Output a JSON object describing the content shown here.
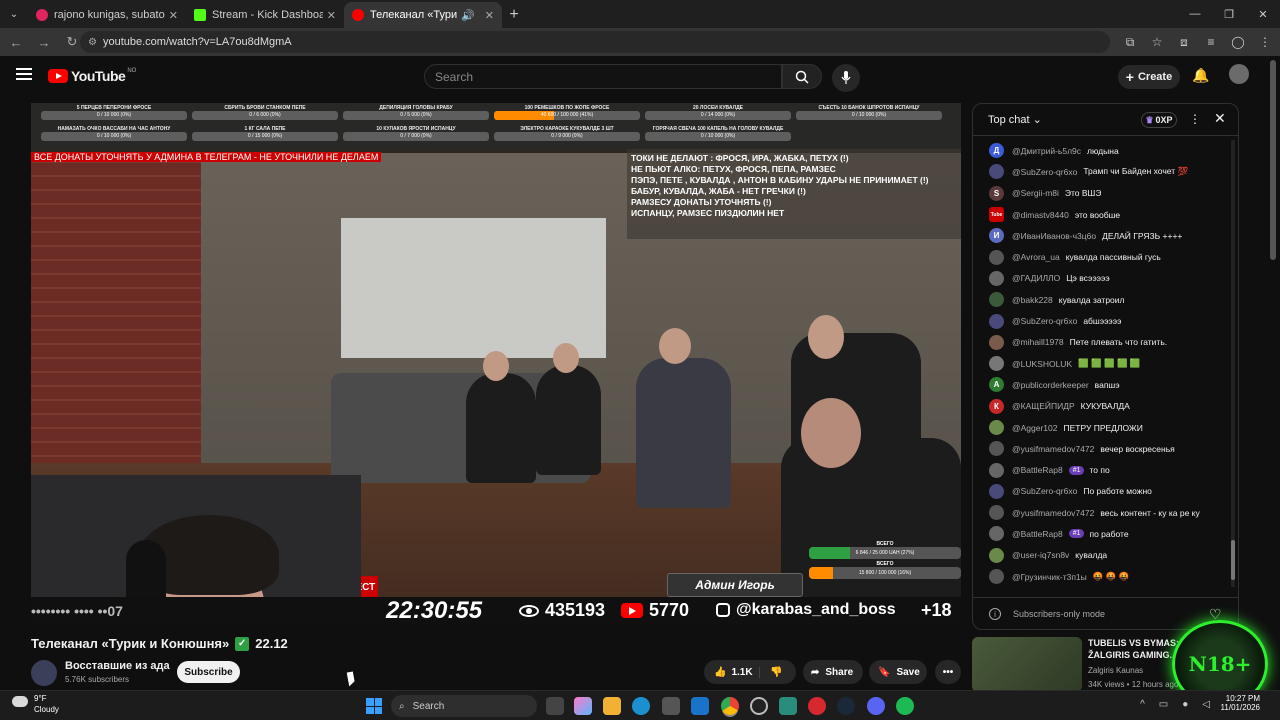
{
  "browser": {
    "tabs": [
      {
        "label": "rajono kunigas, subatono mor",
        "favicon_color": "#e0245e",
        "active": false
      },
      {
        "label": "Stream - Kick Dashboard",
        "favicon_color": "#53fc18",
        "active": false
      },
      {
        "label": "Телеканал «Турик и Конюш",
        "favicon_color": "#ff0000",
        "active": true
      }
    ],
    "url": "youtube.com/watch?v=LA7ou8dMgmA"
  },
  "youtube": {
    "logo_text": "YouTube",
    "logo_region": "NO",
    "search_placeholder": "Search",
    "create_label": "Create"
  },
  "stream_overlay": {
    "goals": [
      {
        "name": "5 ПЕРЦЕВ ПЕПЕРОНИ ФРОСЕ",
        "value": "0 / 10 000 (0%)",
        "progress": 0
      },
      {
        "name": "СБРИТЬ БРОВИ СТАНКОМ ПЕПЕ",
        "value": "0 / 6 000 (0%)",
        "progress": 0
      },
      {
        "name": "ДЕПИЛЯЦИЯ ГОЛОВЫ КРАБУ",
        "value": "0 / 5 000 (0%)",
        "progress": 0
      },
      {
        "name": "100 РЕМЕШКОВ ПО ЖОПЕ ФРОСЕ",
        "value": "40 600 / 100 000 (41%)",
        "progress": 0.41
      },
      {
        "name": "20 ЛОСЕЙ КУВАЛДЕ",
        "value": "0 / 14 000 (0%)",
        "progress": 0
      },
      {
        "name": "СЪЕСТЬ 10 БАНОК ШПРОТОВ ИСПАНЦУ",
        "value": "0 / 10 000 (0%)",
        "progress": 0
      },
      {
        "name": "НАМАЗАТЬ ОЧКО ВАССАБИ НА ЧАС АНТОНУ",
        "value": "0 / 10 000 (0%)",
        "progress": 0
      },
      {
        "name": "1 КГ САЛА ПЕПЕ",
        "value": "0 / 15 000 (0%)",
        "progress": 0
      },
      {
        "name": "10 КУЛАКОВ ЯРОСТИ ИСПАНЦУ",
        "value": "0 / 7 000 (0%)",
        "progress": 0
      },
      {
        "name": "ЭЛЕКТРО КАРАОКЕ КУКУВАЛДЕ 3 ШТ",
        "value": "0 / 9 000 (0%)",
        "progress": 0
      },
      {
        "name": "ГОРЯЧАЯ СВЕЧА 100 КАПЕЛЬ НА ГОЛОВУ КУВАЛДЕ",
        "value": "0 / 10 000 (0%)",
        "progress": 0
      }
    ],
    "red_banner": "ВСЕ ДОНАТЫ УТОЧНЯТЬ У АДМИНА В ТЕЛЕГРАМ - НЕ УТОЧНИЛИ НЕ ДЕЛАЕМ",
    "rules": [
      "ТОКИ НЕ ДЕЛАЮТ : ФРОСЯ, ИРА, ЖАБКА, ПЕТУХ (!)",
      "НЕ ПЬЮТ АЛКО: ПЕТУХ, ФРОСЯ, ПЕПА, РАМЗЕС",
      "ПЭПЭ, ПЕТЕ , КУВАЛДА , АНТОН В КАБИНУ УДАРЫ НЕ ПРИНИМАЕТ (!)",
      "БАБУР, КУВАЛДА, ЖАБА -  НЕТ ГРЕЧКИ (!)",
      "РАМЗЕСУ ДОНАТЫ УТОЧНЯТЬ (!)",
      " ИСПАНЦУ, РАМЗЕС  ПИЗДЮЛИН НЕТ"
    ],
    "admin_plate": "Админ Игорь",
    "red_chat_label": "АТ БЕСТ",
    "totals": [
      {
        "label": "ВСЕГО",
        "value": "6 846 / 25 000 UAH (27%)",
        "progress": 0.27,
        "color": "#2ea043"
      },
      {
        "label": "ВСЕГО",
        "value": "15 800 / 100 000 (16%)",
        "progress": 0.16,
        "color": "#ff8c00"
      }
    ],
    "ticker_left": "•••••••• ••••   ••07",
    "clock": "22:30:55",
    "viewers": "435193",
    "yt_subs": "5770",
    "instagram": "@karabas_and_boss",
    "plus18": "+18"
  },
  "video_info": {
    "title": "Телеканал «Турик и Конюшня»",
    "title_suffix": "22.12",
    "channel_name": "Восставшие из ада",
    "channel_subs": "5.76K subscribers",
    "subscribe_label": "Subscribe",
    "like_count": "1.1K",
    "share_label": "Share",
    "save_label": "Save"
  },
  "chat": {
    "header": "Top chat",
    "xp_label": "0XP",
    "messages": [
      {
        "avatar_letter": "Д",
        "avatar_color": "#3b5bdb",
        "author": "@Дмитрий-ь5л9с",
        "text": "людына",
        "badge": ""
      },
      {
        "avatar_letter": "",
        "avatar_color": "#4a4a7a",
        "author": "@SubZero-qr6xo",
        "text": "Трамп чи Байден хочет 💯",
        "badge": ""
      },
      {
        "avatar_letter": "S",
        "avatar_color": "#5a3a3a",
        "author": "@Sergii-m8i",
        "text": "Это ВШЭ",
        "badge": ""
      },
      {
        "avatar_letter": "Tube",
        "avatar_color": "#c00",
        "author": "@dimastv8440",
        "text": "это вообше",
        "badge": ""
      },
      {
        "avatar_letter": "И",
        "avatar_color": "#5c6bc0",
        "author": "@ИванИванов-ч3ц6о",
        "text": "ДЕЛАЙ ГРЯЗЬ ++++",
        "badge": ""
      },
      {
        "avatar_letter": "",
        "avatar_color": "#555",
        "author": "@Avrora_ua",
        "text": "кувалда пассивный гусь",
        "badge": ""
      },
      {
        "avatar_letter": "",
        "avatar_color": "#666",
        "author": "@ГАДИЛЛО",
        "text": "Цэ всэээээ",
        "badge": ""
      },
      {
        "avatar_letter": "",
        "avatar_color": "#3a5a3a",
        "author": "@bakk228",
        "text": "кувалда затроил",
        "badge": ""
      },
      {
        "avatar_letter": "",
        "avatar_color": "#4a4a7a",
        "author": "@SubZero-qr6xo",
        "text": "абшэээээ",
        "badge": ""
      },
      {
        "avatar_letter": "",
        "avatar_color": "#7a5a4a",
        "author": "@mihaill1978",
        "text": "Пете плевать что гатить.",
        "badge": ""
      },
      {
        "avatar_letter": "",
        "avatar_color": "#777",
        "author": "@LUKSHOLUK",
        "text": "🟩 🟩 🟩 🟩 🟩",
        "badge": ""
      },
      {
        "avatar_letter": "A",
        "avatar_color": "#2e7d32",
        "author": "@publicorderkeeper",
        "text": "вапшэ",
        "badge": ""
      },
      {
        "avatar_letter": "К",
        "avatar_color": "#c62828",
        "author": "@КАЩЕЙПИДР",
        "text": "КУКУВАЛДА",
        "badge": ""
      },
      {
        "avatar_letter": "",
        "avatar_color": "#6a8a4a",
        "author": "@Agger102",
        "text": "ПЕТРУ ПРЕДЛОЖИ",
        "badge": ""
      },
      {
        "avatar_letter": "",
        "avatar_color": "#555",
        "author": "@yusifmamedov7472",
        "text": "вечер воскресенья",
        "badge": ""
      },
      {
        "avatar_letter": "",
        "avatar_color": "#666",
        "author": "@BattleRap8",
        "text": "то по",
        "badge": "#1"
      },
      {
        "avatar_letter": "",
        "avatar_color": "#4a4a7a",
        "author": "@SubZero-qr6xo",
        "text": "По работе можно",
        "badge": ""
      },
      {
        "avatar_letter": "",
        "avatar_color": "#555",
        "author": "@yusifmamedov7472",
        "text": "весь контент - ку ка ре ку",
        "badge": ""
      },
      {
        "avatar_letter": "",
        "avatar_color": "#666",
        "author": "@BattleRap8",
        "text": "по работе",
        "badge": "#1"
      },
      {
        "avatar_letter": "",
        "avatar_color": "#6a8a4a",
        "author": "@user-iq7sn8v",
        "text": "кувалда",
        "badge": ""
      },
      {
        "avatar_letter": "",
        "avatar_color": "#555",
        "author": "@Грузинчик-т3п1ы",
        "text": "🤬 🤬 🤬",
        "badge": ""
      }
    ],
    "footer": "Subscribers-only mode"
  },
  "recommendation": {
    "title": "TUBELIS VS BYMAS: CS2 ŽALGIRIS GAMING...",
    "channel": "Zalgiris Kaunas",
    "meta": "34K views • 12 hours ago",
    "badge": "N18+"
  },
  "taskbar": {
    "weather_temp": "9°F",
    "weather_desc": "Cloudy",
    "search_label": "Search",
    "time": "10:27 PM",
    "date": "11/01/2026"
  }
}
